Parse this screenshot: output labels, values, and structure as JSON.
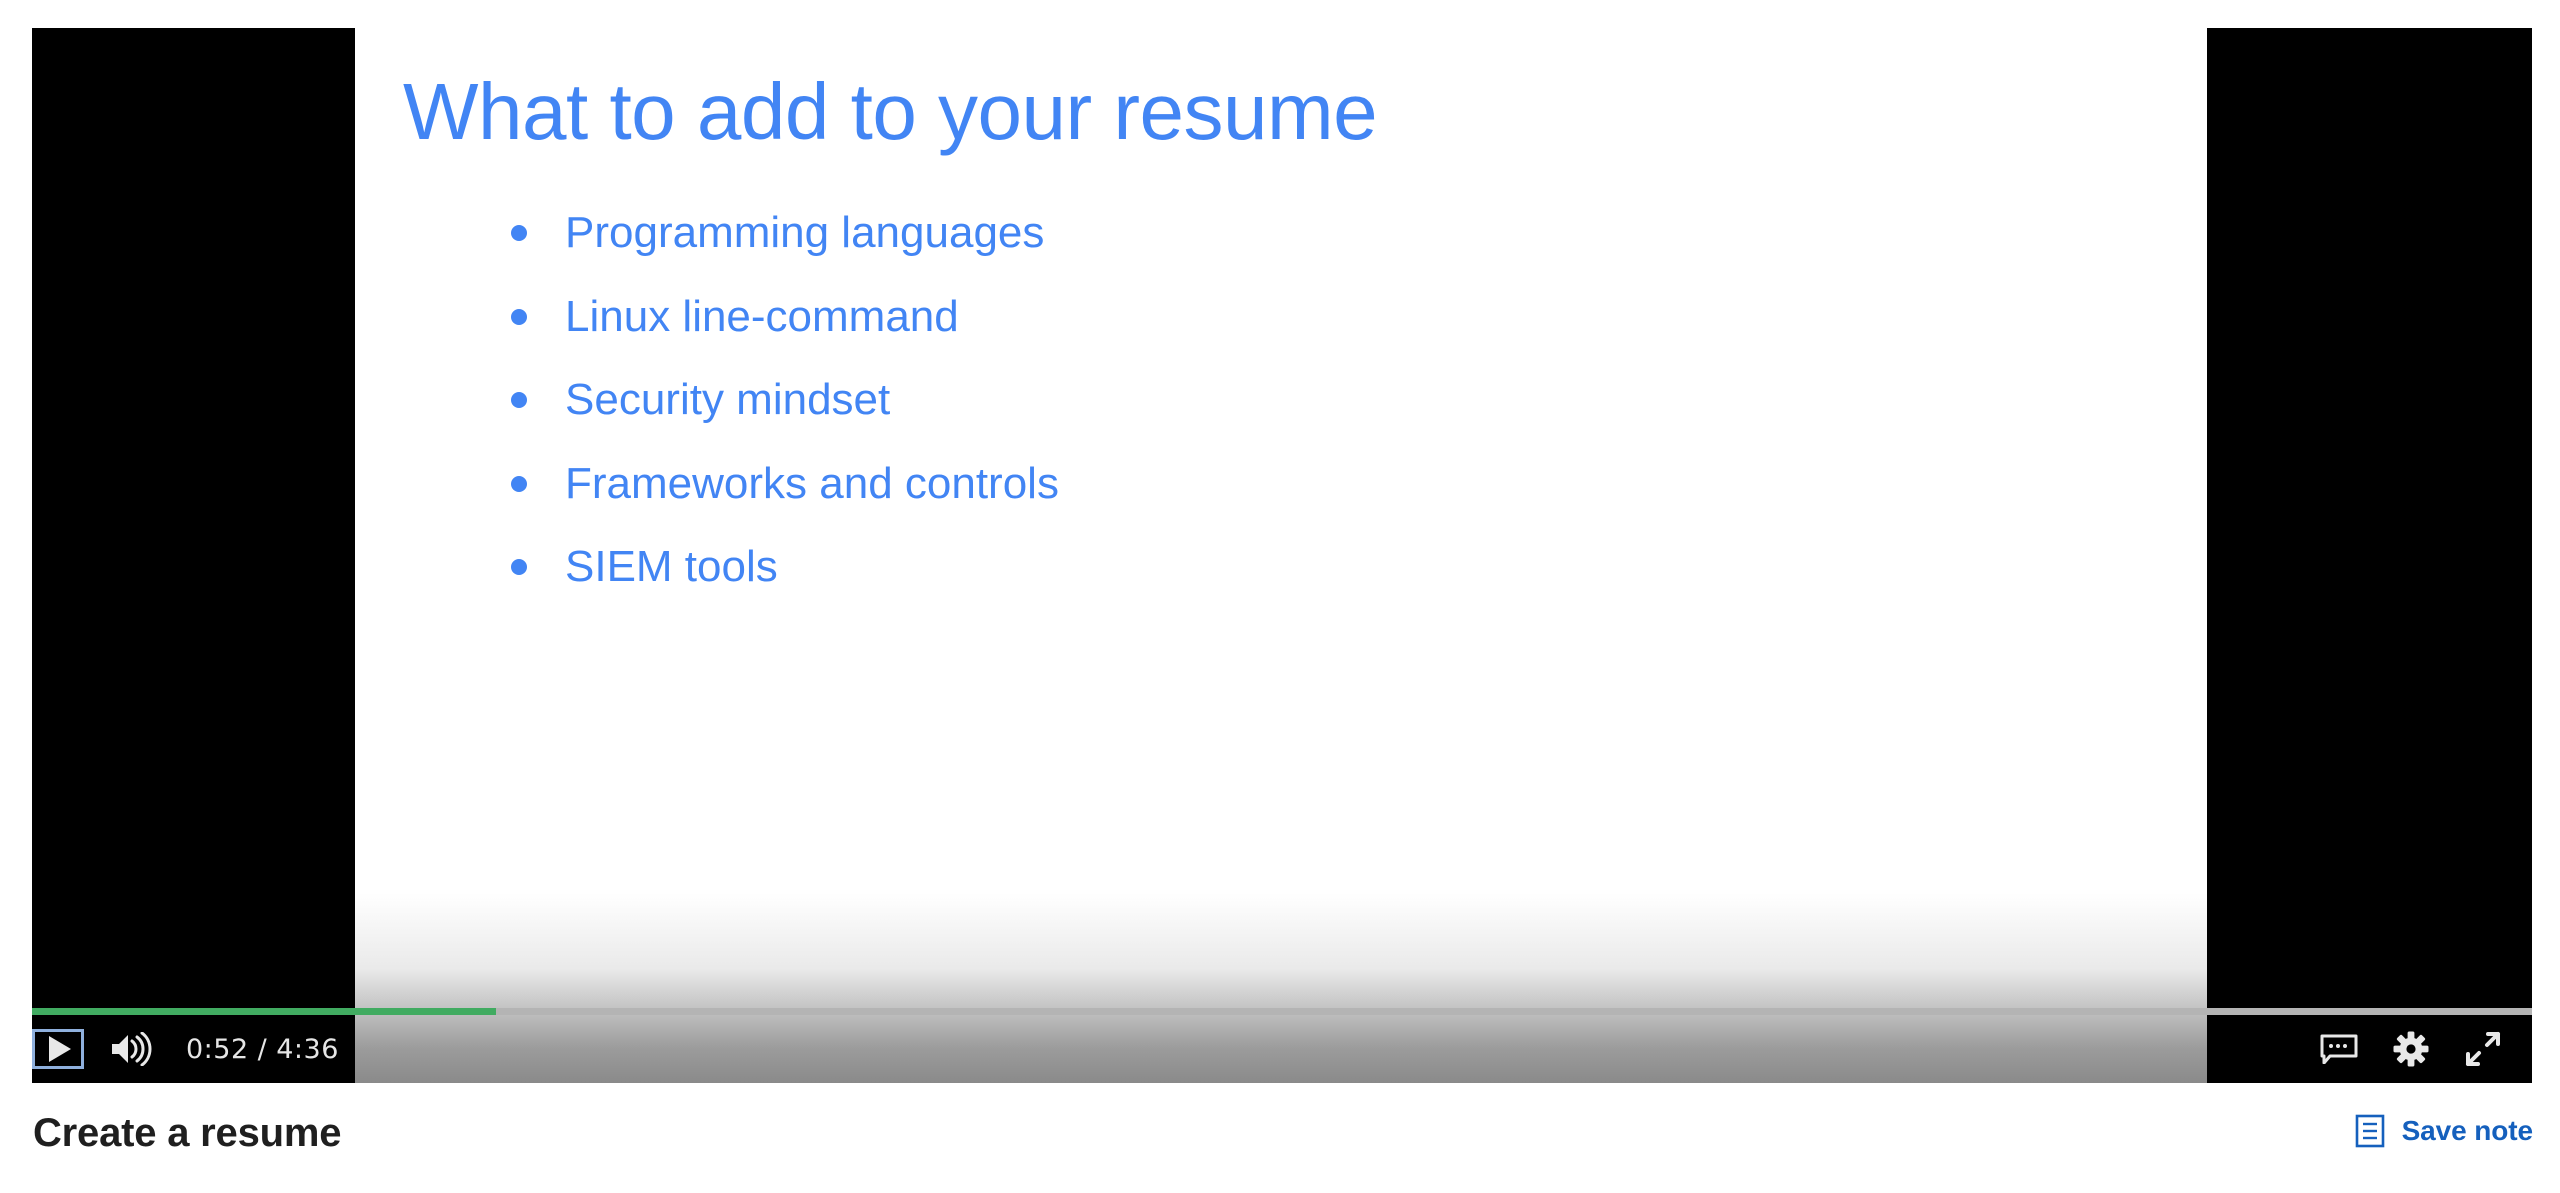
{
  "colors": {
    "slide_accent": "#4285f4",
    "progress_played": "#41ab61",
    "progress_track": "#b4b4b4",
    "save_note_blue": "#1560bd",
    "heading_text": "#1f1f1f",
    "letterbox": "#000000"
  },
  "slide": {
    "title": "What to add to your resume",
    "bullets": [
      "Programming languages",
      "Linux line-command",
      "Security mindset",
      "Frameworks and controls",
      "SIEM tools"
    ]
  },
  "player": {
    "play_button": {
      "icon": "play-icon",
      "state": "paused",
      "focused": true
    },
    "volume_button": {
      "icon": "volume-high-icon",
      "state": "unmuted"
    },
    "current_time": "0:52",
    "time_separator": "/",
    "duration": "4:36",
    "progress_percent": 18.8,
    "right_controls": [
      {
        "name": "captions-icon",
        "label": "Captions"
      },
      {
        "name": "gear-icon",
        "label": "Settings"
      },
      {
        "name": "fullscreen-icon",
        "label": "Full screen"
      }
    ]
  },
  "footer": {
    "video_heading": "Create a resume",
    "save_note": {
      "icon": "note-icon",
      "label": "Save note"
    }
  }
}
